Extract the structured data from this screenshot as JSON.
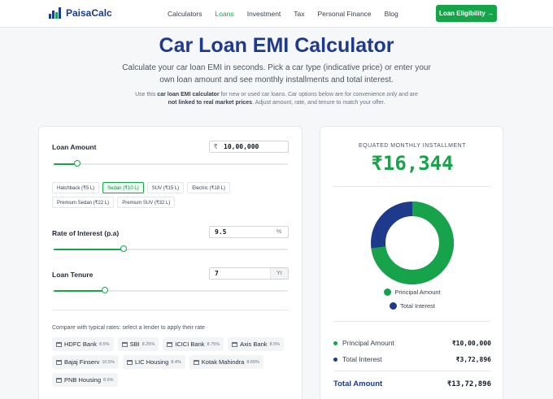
{
  "nav": {
    "brand": "PaisaCalc",
    "links": [
      "Calculators",
      "Loans",
      "Investment",
      "Tax",
      "Personal Finance",
      "Blog"
    ],
    "active": "Loans",
    "cta": "Loan Eligibility →"
  },
  "hero": {
    "title": "Car Loan EMI Calculator",
    "subtitle": "Calculate your car loan EMI in seconds. Pick a car type (indicative price) or enter your own loan amount and see monthly installments and total interest.",
    "note_pre": "Use this ",
    "note_b1": "car loan EMI calculator",
    "note_mid": " for new or used car loans. Car options below are for convenience only and are ",
    "note_b2": "not linked to real market prices",
    "note_post": ". Adjust amount, rate, and tenure to match your offer."
  },
  "loan_amount": {
    "label": "Loan Amount",
    "prefix": "₹",
    "value": "10,00,000",
    "slider_fraction": 0.1
  },
  "car_types": [
    {
      "label": "Hatchback (₹5 L)",
      "selected": false
    },
    {
      "label": "Sedan (₹10 L)",
      "selected": true
    },
    {
      "label": "SUV (₹15 L)",
      "selected": false
    },
    {
      "label": "Electric (₹18 L)",
      "selected": false
    },
    {
      "label": "Premium Sedan (₹22 L)",
      "selected": false
    },
    {
      "label": "Premium SUV (₹32 L)",
      "selected": false
    }
  ],
  "rate": {
    "label": "Rate of Interest (p.a)",
    "value": "9.5",
    "suffix": "%",
    "slider_fraction": 0.3
  },
  "tenure": {
    "label": "Loan Tenure",
    "value": "7",
    "suffix": "Yr",
    "slider_fraction": 0.22
  },
  "compare": {
    "text": "Compare with typical rates: select a lender to apply their rate",
    "banks": [
      {
        "name": "HDFC Bank",
        "rate": "8.5%"
      },
      {
        "name": "SBI",
        "rate": "8.25%"
      },
      {
        "name": "ICICI Bank",
        "rate": "8.75%"
      },
      {
        "name": "Axis Bank",
        "rate": "8.5%"
      },
      {
        "name": "Bajaj Finserv",
        "rate": "10.5%"
      },
      {
        "name": "LIC Housing",
        "rate": "8.4%"
      },
      {
        "name": "Kotak Mahindra",
        "rate": "8.65%"
      },
      {
        "name": "PNB Housing",
        "rate": "8.6%"
      }
    ]
  },
  "result": {
    "emi_label": "EQUATED MONTHLY INSTALLMENT",
    "emi_value": "₹16,344",
    "principal_label": "Principal Amount",
    "principal_value": "₹10,00,000",
    "interest_label": "Total Interest",
    "interest_value": "₹3,72,896",
    "total_label": "Total Amount",
    "total_value": "₹13,72,896",
    "principal_share": 0.7284
  },
  "colors": {
    "principal": "#16a34a",
    "interest": "#1e3a8a",
    "brand": "#1e3a8a",
    "accent": "#16a34a"
  }
}
